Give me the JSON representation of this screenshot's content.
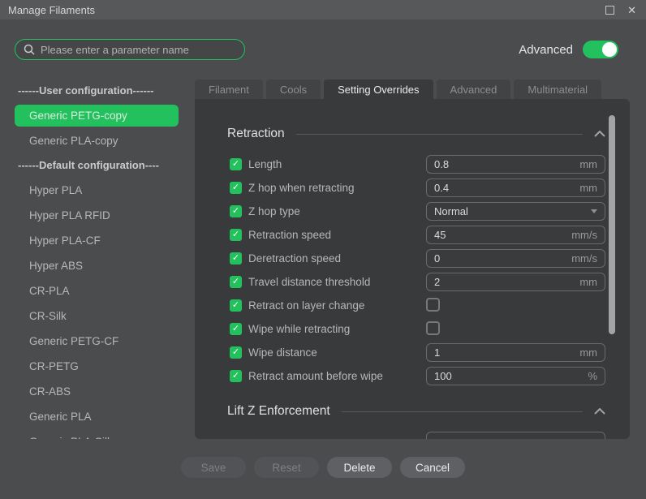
{
  "window": {
    "title": "Manage Filaments"
  },
  "icons": {
    "check": "✓",
    "close": "✕",
    "maximize": "maximize-box",
    "search": "magnifier",
    "collapse": "chevron-up",
    "dropdown": "caret-down"
  },
  "colors": {
    "accent_green": "#22c15d",
    "panel_bg": "#393a3c",
    "window_bg": "#4b4c4e",
    "titlebar_bg": "#57585a"
  },
  "search": {
    "placeholder": "Please enter a parameter name"
  },
  "advanced_toggle": {
    "label": "Advanced",
    "state": "on"
  },
  "sidebar": {
    "groups": [
      {
        "header": "------User configuration------",
        "items": [
          {
            "label": "Generic PETG-copy",
            "selected": true
          },
          {
            "label": "Generic PLA-copy",
            "selected": false
          }
        ]
      },
      {
        "header": "------Default configuration----",
        "items": [
          {
            "label": "Hyper PLA",
            "selected": false
          },
          {
            "label": "Hyper PLA RFID",
            "selected": false
          },
          {
            "label": "Hyper PLA-CF",
            "selected": false
          },
          {
            "label": "Hyper ABS",
            "selected": false
          },
          {
            "label": "CR-PLA",
            "selected": false
          },
          {
            "label": "CR-Silk",
            "selected": false
          },
          {
            "label": "Generic PETG-CF",
            "selected": false
          },
          {
            "label": "CR-PETG",
            "selected": false
          },
          {
            "label": "CR-ABS",
            "selected": false
          },
          {
            "label": "Generic PLA",
            "selected": false
          },
          {
            "label": "Generic PLA-Silk",
            "selected": false
          }
        ]
      }
    ]
  },
  "tabs": [
    {
      "label": "Filament",
      "active": false
    },
    {
      "label": "Cools",
      "active": false
    },
    {
      "label": "Setting Overrides",
      "active": true
    },
    {
      "label": "Advanced",
      "active": false
    },
    {
      "label": "Multimaterial",
      "active": false
    }
  ],
  "sections": [
    {
      "title": "Retraction",
      "rows": [
        {
          "label": "Length",
          "checked": true,
          "control": "input",
          "value": "0.8",
          "unit": "mm"
        },
        {
          "label": "Z hop when retracting",
          "checked": true,
          "control": "input",
          "value": "0.4",
          "unit": "mm"
        },
        {
          "label": "Z hop type",
          "checked": true,
          "control": "select",
          "value": "Normal"
        },
        {
          "label": "Retraction speed",
          "checked": true,
          "control": "input",
          "value": "45",
          "unit": "mm/s"
        },
        {
          "label": "Deretraction speed",
          "checked": true,
          "control": "input",
          "value": "0",
          "unit": "mm/s"
        },
        {
          "label": "Travel distance threshold",
          "checked": true,
          "control": "input",
          "value": "2",
          "unit": "mm"
        },
        {
          "label": "Retract on layer change",
          "checked": true,
          "control": "checkbox",
          "value": false
        },
        {
          "label": "Wipe while retracting",
          "checked": true,
          "control": "checkbox",
          "value": false
        },
        {
          "label": "Wipe distance",
          "checked": true,
          "control": "input",
          "value": "1",
          "unit": "mm"
        },
        {
          "label": "Retract amount before wipe",
          "checked": true,
          "control": "input",
          "value": "100",
          "unit": "%"
        }
      ],
      "partial_input_visible": false
    },
    {
      "title": "Lift Z Enforcement",
      "rows": [],
      "partial_input_visible": true
    }
  ],
  "footer": {
    "buttons": [
      {
        "label": "Save",
        "enabled": false
      },
      {
        "label": "Reset",
        "enabled": false
      },
      {
        "label": "Delete",
        "enabled": true
      },
      {
        "label": "Cancel",
        "enabled": true
      }
    ]
  }
}
